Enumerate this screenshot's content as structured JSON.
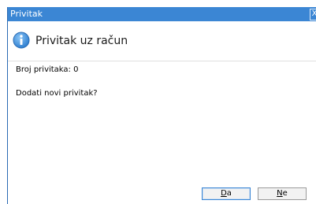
{
  "window": {
    "title": "Privitak",
    "close_glyph": "X"
  },
  "header": {
    "icon": "info-icon",
    "title": "Privitak uz račun"
  },
  "content": {
    "count_text": "Broj privitaka: 0",
    "question": "Dodati novi privitak?"
  },
  "buttons": {
    "yes_first": "D",
    "yes_rest": "a",
    "no_first": "N",
    "no_rest": "e"
  },
  "colors": {
    "titlebar": "#3b86d4",
    "icon": "#3b8fe0"
  }
}
